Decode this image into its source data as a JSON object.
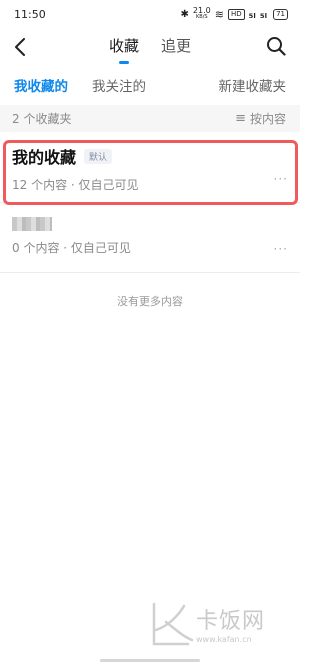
{
  "status_bar": {
    "time": "11:50",
    "bluetooth": "✱",
    "net_speed": "21.0",
    "net_unit": "KB/S",
    "wifi": "≋",
    "hd": "HD",
    "sig1": "₅ₗ",
    "sig2": "₅ₗ",
    "battery": "71"
  },
  "nav": {
    "tabs": [
      {
        "label": "收藏",
        "active": true
      },
      {
        "label": "追更",
        "active": false
      }
    ]
  },
  "subtabs": [
    {
      "label": "我收藏的",
      "active": true
    },
    {
      "label": "我关注的",
      "active": false
    },
    {
      "label": "新建收藏夹",
      "active": false
    }
  ],
  "list_header": {
    "count_label": "2 个收藏夹",
    "sort_icon": "≡",
    "sort_label": "按内容"
  },
  "folders": [
    {
      "title": "我的收藏",
      "badge": "默认",
      "meta": "12 个内容 · 仅自己可见",
      "more": "···"
    },
    {
      "title": "",
      "meta": "0 个内容 · 仅自己可见",
      "more": "···"
    }
  ],
  "end_note": "没有更多内容",
  "watermark": {
    "text": "卡饭网",
    "url": "www.kafan.cn"
  },
  "colors": {
    "accent": "#0f88eb",
    "highlight": "#ef5b5b"
  }
}
